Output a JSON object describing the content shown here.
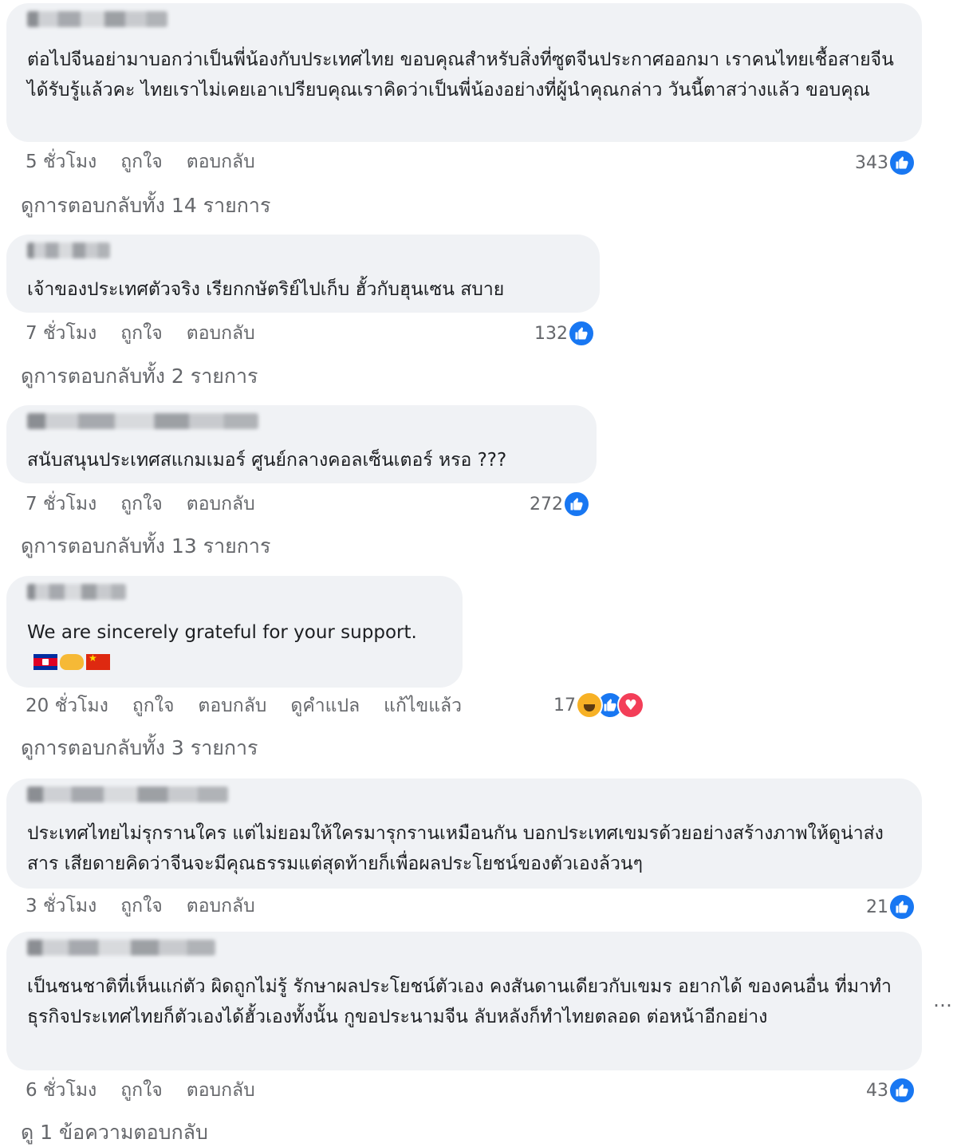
{
  "comments": [
    {
      "text": "ต่อไปจีนอย่ามาบอกว่าเป็นพี่น้องกับประเทศไทย ขอบคุณสำหรับสิ่งที่ซูตจีนประกาศออกมา เราคนไทยเชื้อสายจีนได้รับรู้แล้วคะ ไทยเราไม่เคยเอาเปรียบคุณเราคิดว่าเป็นพี่น้องอย่างที่ผู้นำคุณกล่าว วันนี้ตาสว่างแล้ว ขอบคุณ",
      "time": "5 ชั่วโมง",
      "like": "ถูกใจ",
      "reply": "ตอบกลับ",
      "reaction_count": "343",
      "view_replies": "ดูการตอบกลับทั้ง 14 รายการ"
    },
    {
      "text": "เจ้าของประเทศตัวจริง เรียกกษัตริย์ไปเก็บ ฮั้วกับฮุนเซน สบาย",
      "time": "7 ชั่วโมง",
      "like": "ถูกใจ",
      "reply": "ตอบกลับ",
      "reaction_count": "132",
      "view_replies": "ดูการตอบกลับทั้ง 2 รายการ"
    },
    {
      "text": "สนับสนุนประเทศสแกมเมอร์ ศูนย์กลางคอลเซ็นเตอร์ หรอ ???",
      "time": "7 ชั่วโมง",
      "like": "ถูกใจ",
      "reply": "ตอบกลับ",
      "reaction_count": "272",
      "view_replies": "ดูการตอบกลับทั้ง 13 รายการ"
    },
    {
      "text": "We are sincerely grateful for your support.",
      "time": "20 ชั่วโมง",
      "like": "ถูกใจ",
      "reply": "ตอบกลับ",
      "translate": "ดูคำแปล",
      "edited": "แก้ไขแล้ว",
      "reaction_count": "17",
      "view_replies": "ดูการตอบกลับทั้ง 3 รายการ"
    },
    {
      "text": "ประเทศไทยไม่รุกรานใคร แต่ไม่ยอมให้ใครมารุกรานเหมือนกัน บอกประเทศเขมรด้วยอย่างสร้างภาพให้ดูน่าส่งสาร เสียดายคิดว่าจีนจะมีคุณธรรมแต่สุดท้ายก็เพื่อผลประโยชน์ของตัวเองล้วนๆ",
      "time": "3 ชั่วโมง",
      "like": "ถูกใจ",
      "reply": "ตอบกลับ",
      "reaction_count": "21"
    },
    {
      "text": "เป็นชนชาติที่เห็นแก่ตัว ผิดถูกไม่รู้ รักษาผลประโยชน์ตัวเอง คงสันดานเดียวกับเขมร อยากได้ ของคนอื่น ที่มาทำธุรกิจประเทศไทยก็ตัวเองได้ฮั้วเองทั้งนั้น กูขอประนามจีน ลับหลังก็ทำไทยตลอด ต่อหน้าอีกอย่าง",
      "time": "6 ชั่วโมง",
      "like": "ถูกใจ",
      "reply": "ตอบกลับ",
      "reaction_count": "43",
      "view_replies": "ดู 1 ข้อความตอบกลับ"
    }
  ],
  "more_label": "…",
  "icons": {
    "like": "like-thumb-icon",
    "haha": "haha-reaction-icon",
    "love": "love-reaction-icon"
  },
  "colors": {
    "bubble": "#f0f2f5",
    "like_blue": "#1877f2",
    "meta_gray": "#65676b"
  }
}
